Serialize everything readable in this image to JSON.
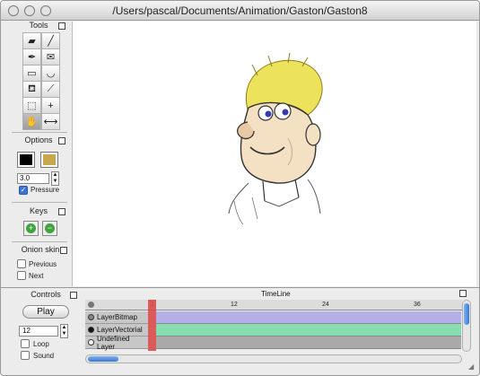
{
  "window": {
    "title": "/Users/pascal/Documents/Animation/Gaston/Gaston8"
  },
  "tools": {
    "header": "Tools",
    "items": [
      {
        "name": "eraser-icon",
        "glyph": "▰"
      },
      {
        "name": "brush-icon",
        "glyph": "╱"
      },
      {
        "name": "pen-icon",
        "glyph": "✒"
      },
      {
        "name": "envelope-icon",
        "glyph": "✉"
      },
      {
        "name": "smudge-icon",
        "glyph": "▭"
      },
      {
        "name": "lasso-icon",
        "glyph": "◡"
      },
      {
        "name": "paint-bucket-icon",
        "glyph": "⛾"
      },
      {
        "name": "eyedropper-icon",
        "glyph": "⟋"
      },
      {
        "name": "marquee-icon",
        "glyph": "⬚"
      },
      {
        "name": "move-icon",
        "glyph": "+"
      },
      {
        "name": "hand-icon",
        "glyph": "✋"
      },
      {
        "name": "stretch-icon",
        "glyph": "⟷"
      }
    ]
  },
  "options": {
    "header": "Options",
    "brush_size": "3.0",
    "pressure_label": "Pressure",
    "pressure_checked": true,
    "primary_color": "#000000",
    "secondary_color": "#c8a84a"
  },
  "keys": {
    "header": "Keys"
  },
  "onion_skin": {
    "header": "Onion skin",
    "previous_label": "Previous",
    "next_label": "Next"
  },
  "controls": {
    "header": "Controls",
    "play_label": "Play",
    "fps": "12",
    "loop_label": "Loop",
    "sound_label": "Sound"
  },
  "timeline": {
    "header": "TimeLine",
    "ticks": [
      "1",
      "12",
      "24",
      "36"
    ],
    "layers": [
      {
        "label": "LayerBitmap",
        "color": "#b4b0e6"
      },
      {
        "label": "LayerVectorial",
        "color": "#88ddb0"
      },
      {
        "label": "Undefined Layer",
        "color": "#a9a9a9"
      }
    ],
    "playhead_color": "#d94b4b"
  }
}
